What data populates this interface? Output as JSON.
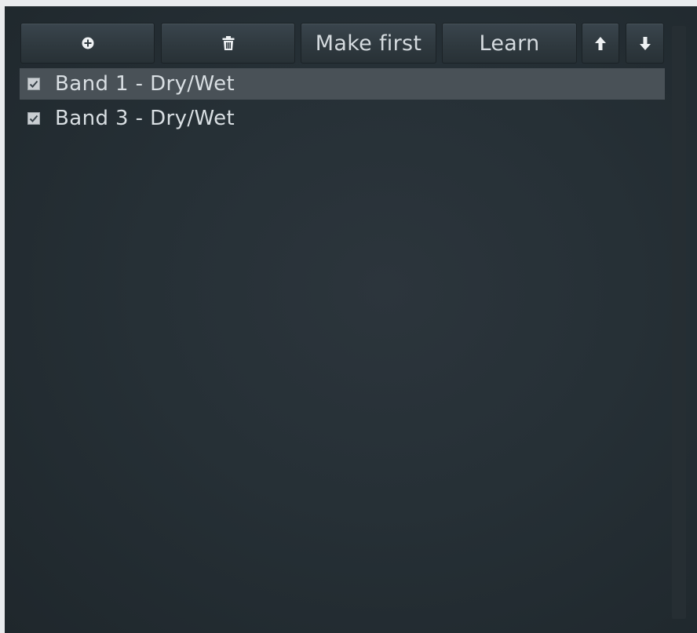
{
  "toolbar": {
    "add_icon": "plus-circle-icon",
    "delete_icon": "trash-icon",
    "make_first_label": "Make first",
    "learn_label": "Learn",
    "move_up_icon": "arrow-up-icon",
    "move_down_icon": "arrow-down-icon"
  },
  "list": {
    "items": [
      {
        "label": "Band 1 - Dry/Wet",
        "checked": true,
        "selected": true
      },
      {
        "label": "Band 3 - Dry/Wet",
        "checked": true,
        "selected": false
      }
    ]
  },
  "colors": {
    "panel_background": "#263036",
    "button_face": "#323c42",
    "selected_row": "#495157",
    "text": "#d9dfe3"
  }
}
